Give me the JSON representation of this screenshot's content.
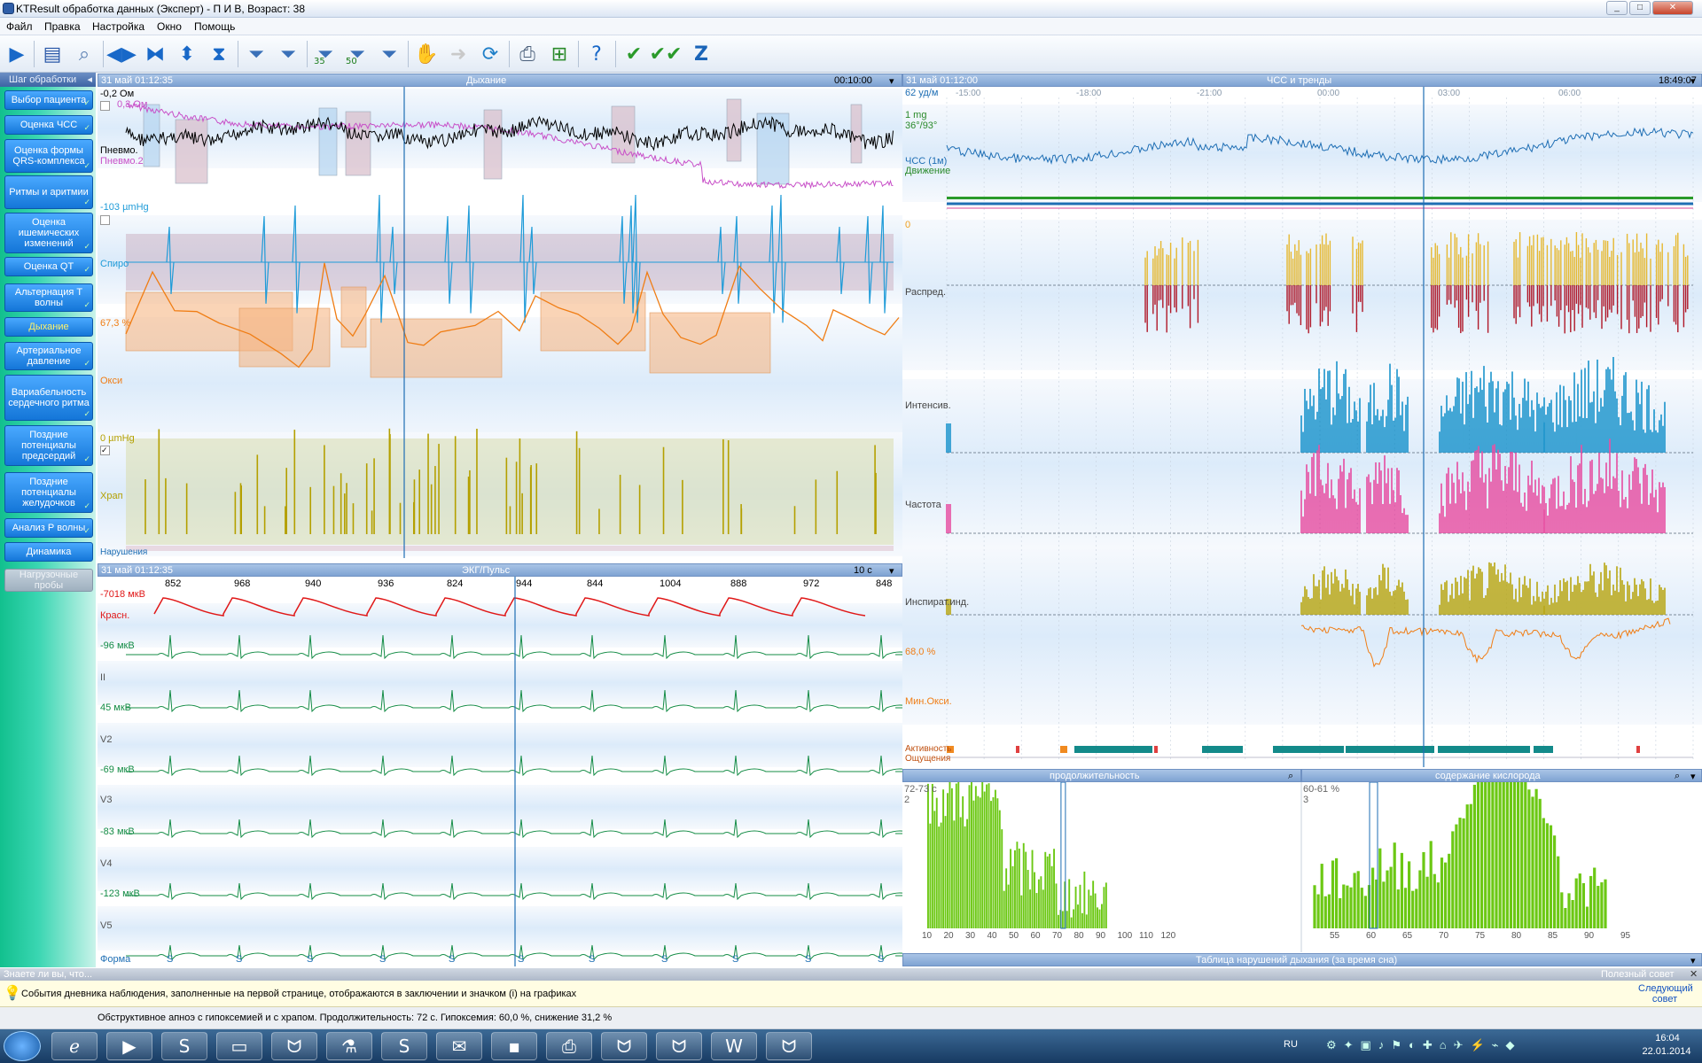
{
  "window": {
    "title": "KTResult обработка данных (Эксперт)  - П И В,  Возраст: 38",
    "controls": [
      "_",
      "□",
      "✕"
    ]
  },
  "menu": [
    "Файл",
    "Правка",
    "Настройка",
    "Окно",
    "Помощь"
  ],
  "toolbar": {
    "icons": [
      "play-icon",
      "book-icon",
      "zoom-icon",
      "left-right-icon",
      "bowtie-icon",
      "up-down-icon",
      "hourglass-icon",
      "filter-icon",
      "filter-icon",
      "filter-35-icon",
      "filter-50-icon",
      "filter-icon",
      "hand-icon",
      "arrow-icon",
      "refresh-icon",
      "print-icon",
      "add-page-icon",
      "help-icon",
      "check-icon",
      "double-check-icon",
      "z-icon"
    ],
    "filter_35": "35",
    "filter_50": "50",
    "z_label": "Z"
  },
  "steps": {
    "header": "Шаг обработки",
    "items": [
      {
        "label": "Выбор пациента",
        "state": "done"
      },
      {
        "label": "Оценка ЧСС",
        "state": "done"
      },
      {
        "label": "Оценка формы QRS-комплекса",
        "state": "done"
      },
      {
        "label": "Ритмы и аритмии",
        "state": "done"
      },
      {
        "label": "Оценка ишемических изменений",
        "state": "done"
      },
      {
        "label": "Оценка QT",
        "state": "done"
      },
      {
        "label": "Альтернация Т волны",
        "state": "done"
      },
      {
        "label": "Дыхание",
        "state": "active"
      },
      {
        "label": "Артериальное давление",
        "state": "done"
      },
      {
        "label": "Вариабельность сердечного ритма",
        "state": "done"
      },
      {
        "label": "Поздние потенциалы предсердий",
        "state": "done"
      },
      {
        "label": "Поздние потенциалы желудочков",
        "state": "done"
      },
      {
        "label": "Анализ Р волны",
        "state": "done"
      },
      {
        "label": "Динамика",
        "state": "normal"
      },
      {
        "label": "Нагрузочные пробы",
        "state": "disabled"
      }
    ]
  },
  "breath_panel": {
    "date": "31 май 01:12:35",
    "title": "Дыхание",
    "duration": "00:10:00",
    "channels": {
      "pneumo1_scale": "-0,2 Ом",
      "pneumo2_scale": "0,3 Ом",
      "pneumo1": "Пневмо.",
      "pneumo2": "Пневмо.2",
      "spiro_scale": "-103 µmHg",
      "spiro": "Спиро",
      "oxy_scale": "67,3 %",
      "oxy": "Окси",
      "snore_scale": "0 µmHg",
      "snore": "Храп",
      "violations": "Нарушения"
    }
  },
  "ecg_panel": {
    "date": "31 май 01:12:35",
    "title": "ЭКГ/Пульс",
    "duration": "10 с",
    "rr": [
      "852",
      "968",
      "940",
      "936",
      "824",
      "944",
      "844",
      "1004",
      "888",
      "972",
      "848"
    ],
    "leads": [
      {
        "scale": "-7018 мкВ",
        "name": "Красн."
      },
      {
        "scale": "-96 мкВ",
        "name": "II"
      },
      {
        "scale": "45 мкВ",
        "name": "V2"
      },
      {
        "scale": "-69 мкВ",
        "name": "V3"
      },
      {
        "scale": "-83 мкВ",
        "name": "V4"
      },
      {
        "scale": "-123 мкВ",
        "name": "V5"
      }
    ],
    "form_label": "Форма",
    "beat_mark": "S"
  },
  "trend_panel": {
    "date": "31 май 01:12:00",
    "title": "ЧСС и тренды",
    "end": "18:49:07",
    "times": [
      "-15:00",
      "-18:00",
      "-21:00",
      "00:00",
      "03:00",
      "06:00"
    ],
    "hr_scale": "62 уд/м",
    "mg": "1 mg",
    "temp": "36°/93°",
    "hr_label": "ЧСС (1м)",
    "motion": "Движение",
    "distrib_scale": "0",
    "distrib": "Распред.",
    "intensity": "Интенсив.",
    "frequency": "Частота",
    "inspir": "Инспират.инд.",
    "minoxy_scale": "68,0 %",
    "minoxy": "Мин.Окси.",
    "activity": "Активность",
    "sensations": "Ощущения"
  },
  "histograms": {
    "duration": {
      "title": "продолжительность",
      "range": "72-73 с",
      "count": "2",
      "ticks": [
        "10",
        "20",
        "30",
        "40",
        "50",
        "60",
        "70",
        "80",
        "90",
        "100",
        "110",
        "120"
      ]
    },
    "oxygen": {
      "title": "содержание кислорода",
      "range": "60-61 %",
      "count": "3",
      "ticks": [
        "55",
        "60",
        "65",
        "70",
        "75",
        "80",
        "85",
        "90",
        "95"
      ]
    },
    "table_title": "Таблица нарушений дыхания (за время сна)"
  },
  "hint": {
    "header": "Знаете ли вы, что...",
    "right_header": "Полезный совет",
    "text": "События дневника наблюдения, заполненные на первой странице, отображаются в заключении и значком (i) на графиках",
    "next": "Следующий совет"
  },
  "status": "Обструктивное апноэ с гипоксемией и с храпом. Продолжительность: 72 с. Гипоксемия: 60,0 %, снижение 31,2 %",
  "taskbar": {
    "lang": "RU",
    "time": "16:04",
    "date": "22.01.2014"
  },
  "colors": {
    "pneumo1": "#000000",
    "pneumo2": "#c850c8",
    "spiro": "#1e9bd8",
    "oxy": "#f07d14",
    "snore": "#b4a000",
    "ecg": "#148c46",
    "pulse": "#e01818",
    "hr": "#1e6eb4",
    "intensity": "#0a8cc8",
    "frequency": "#e6409a",
    "hist": "#6cc814"
  }
}
